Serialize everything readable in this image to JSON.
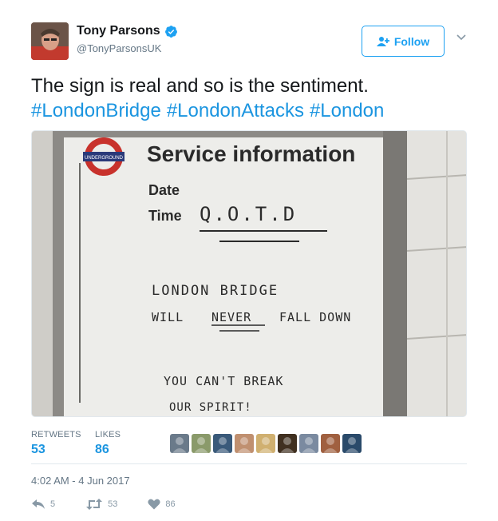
{
  "user": {
    "display_name": "Tony Parsons",
    "handle": "@TonyParsonsUK",
    "verified": true
  },
  "follow_label": "Follow",
  "tweet": {
    "text": "The sign is real and so is the sentiment.",
    "hashtags": [
      "#LondonBridge",
      "#LondonAttacks",
      "#London"
    ]
  },
  "media": {
    "sign_brand": "UNDERGROUND",
    "sign_title": "Service information",
    "sign_date_label": "Date",
    "sign_time_label": "Time",
    "handwriting_time": "Q.O.T.D",
    "handwriting_line1": "LONDON BRIDGE",
    "handwriting_line2_pre": "WILL",
    "handwriting_line2_em": "NEVER",
    "handwriting_line2_post": "FALL DOWN",
    "handwriting_line3": "YOU CAN'T BREAK",
    "handwriting_line4": "OUR SPIRIT!"
  },
  "stats": {
    "retweets_label": "RETWEETS",
    "retweets_value": "53",
    "likes_label": "LIKES",
    "likes_value": "86"
  },
  "likers": [
    "#6a7a8a",
    "#8a9a6a",
    "#3a5a7a",
    "#c09070",
    "#d0b070",
    "#403020",
    "#7a8aa0",
    "#a06040",
    "#2a4a6a"
  ],
  "timestamp": "4:02 AM - 4 Jun 2017",
  "actions": {
    "reply_count": "5",
    "retweet_count": "53",
    "like_count": "86"
  },
  "colors": {
    "accent": "#1da1f2",
    "link": "#1b95e0",
    "muted": "#657786"
  }
}
